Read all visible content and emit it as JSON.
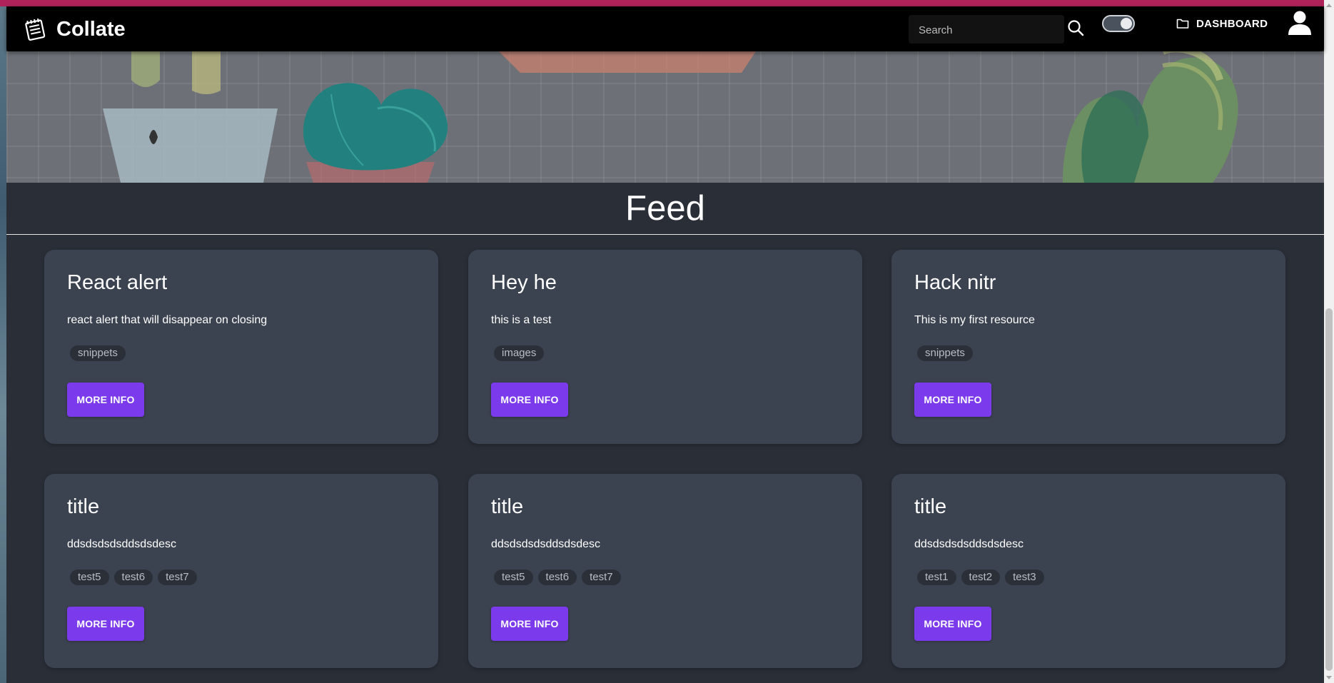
{
  "app": {
    "brand_name": "Collate",
    "brand_icon": "notepad-icon"
  },
  "navbar": {
    "search_placeholder": "Search",
    "search_value": "",
    "search_icon": "search-icon",
    "theme_toggle": {
      "state": "on"
    },
    "dashboard_label": "DASHBOARD",
    "dashboard_icon": "folder-icon",
    "profile_icon": "user-icon"
  },
  "colors": {
    "top_accent": "#b0235a",
    "navbar_bg": "#000000",
    "page_bg": "#2a2e37",
    "card_bg": "#3b4250",
    "button_bg": "#7c3aed",
    "tag_bg": "#2a2f38"
  },
  "feed": {
    "title": "Feed",
    "button_label": "MORE INFO",
    "cards": [
      {
        "title": "React alert",
        "description": "react alert that will disappear on closing",
        "tags": [
          "snippets"
        ]
      },
      {
        "title": "Hey he",
        "description": "this is a test",
        "tags": [
          "images"
        ]
      },
      {
        "title": "Hack nitr",
        "description": "This is my first resource",
        "tags": [
          "snippets"
        ]
      },
      {
        "title": "title",
        "description": "ddsdsdsdsddsdsdesc",
        "tags": [
          "test5",
          "test6",
          "test7"
        ]
      },
      {
        "title": "title",
        "description": "ddsdsdsdsddsdsdesc",
        "tags": [
          "test5",
          "test6",
          "test7"
        ]
      },
      {
        "title": "title",
        "description": "ddsdsdsdsddsdsdesc",
        "tags": [
          "test1",
          "test2",
          "test3"
        ]
      }
    ]
  }
}
